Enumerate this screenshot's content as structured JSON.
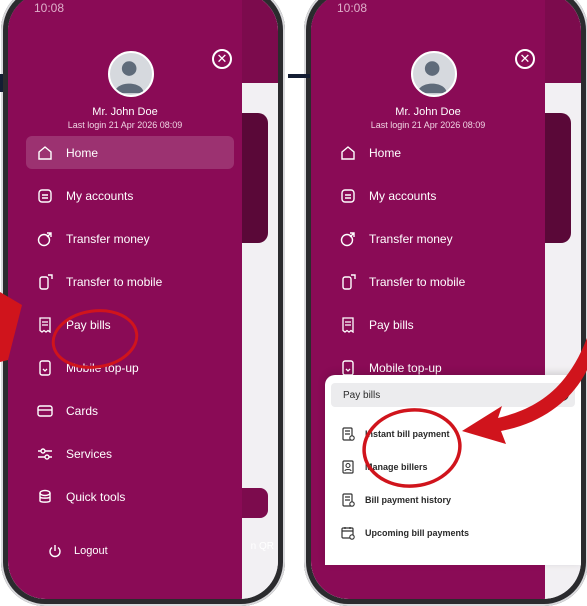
{
  "status_time": "10:08",
  "user": {
    "name": "Mr. John Doe",
    "last_login": "Last login  21 Apr 2026 08:09"
  },
  "menu": [
    {
      "label": "Home",
      "icon": "home-icon"
    },
    {
      "label": "My accounts",
      "icon": "accounts-icon"
    },
    {
      "label": "Transfer money",
      "icon": "transfer-money-icon"
    },
    {
      "label": "Transfer to mobile",
      "icon": "mobile-transfer-icon"
    },
    {
      "label": "Pay bills",
      "icon": "bill-icon"
    },
    {
      "label": "Mobile top-up",
      "icon": "mobile-topup-icon"
    },
    {
      "label": "Cards",
      "icon": "card-icon"
    },
    {
      "label": "Services",
      "icon": "services-icon"
    },
    {
      "label": "Quick tools",
      "icon": "quick-tools-icon"
    }
  ],
  "logout_label": "Logout",
  "pay_bills_sheet": {
    "title": "Pay bills",
    "items": [
      {
        "label": "Instant bill payment",
        "icon": "instant-bill-icon"
      },
      {
        "label": "Manage billers",
        "icon": "manage-billers-icon"
      },
      {
        "label": "Bill payment history",
        "icon": "bill-history-icon"
      },
      {
        "label": "Upcoming bill payments",
        "icon": "upcoming-bills-icon"
      }
    ]
  },
  "background_app": {
    "qr_label": "n QR"
  },
  "colors": {
    "drawer": "#8a0b56",
    "annotation_red": "#d0141c",
    "sheet_bg": "#ffffff"
  }
}
